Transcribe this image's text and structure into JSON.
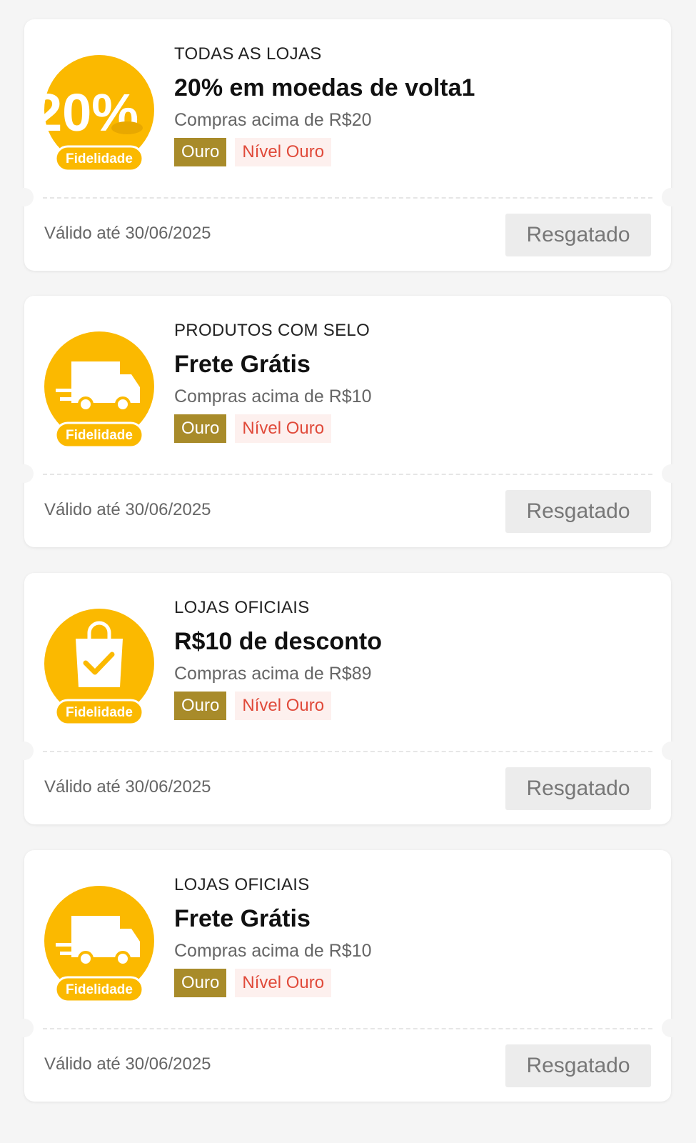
{
  "coupons": [
    {
      "icon": "percent-coin-icon",
      "badge_text": "20%",
      "badge_label": "Fidelidade",
      "category": "TODAS AS LOJAS",
      "title": "20% em moedas de volta1",
      "condition": "Compras acima de R$20",
      "tag": "Ouro",
      "level": "Nível Ouro",
      "valid": "Válido até 30/06/2025",
      "button": "Resgatado"
    },
    {
      "icon": "delivery-truck-icon",
      "badge_label": "Fidelidade",
      "category": "PRODUTOS COM SELO",
      "title": "Frete Grátis",
      "condition": "Compras acima de R$10",
      "tag": "Ouro",
      "level": "Nível Ouro",
      "valid": "Válido até 30/06/2025",
      "button": "Resgatado"
    },
    {
      "icon": "shopping-bag-check-icon",
      "badge_label": "Fidelidade",
      "category": "LOJAS OFICIAIS",
      "title": "R$10 de desconto",
      "condition": "Compras acima de R$89",
      "tag": "Ouro",
      "level": "Nível Ouro",
      "valid": "Válido até 30/06/2025",
      "button": "Resgatado"
    },
    {
      "icon": "delivery-truck-icon",
      "badge_label": "Fidelidade",
      "category": "LOJAS OFICIAIS",
      "title": "Frete Grátis",
      "condition": "Compras acima de R$10",
      "tag": "Ouro",
      "level": "Nível Ouro",
      "valid": "Válido até 30/06/2025",
      "button": "Resgatado"
    }
  ],
  "colors": {
    "badge_yellow": "#fbb900",
    "tag_gold": "#a88b2a",
    "level_red": "#e04a3a"
  }
}
